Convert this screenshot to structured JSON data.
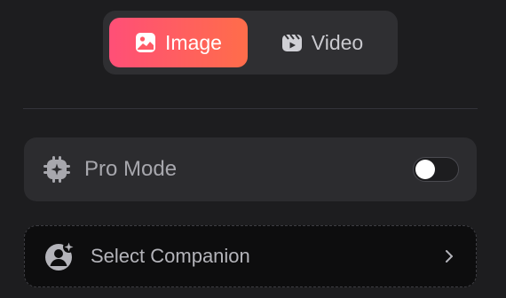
{
  "mode_switch": {
    "image_label": "Image",
    "video_label": "Video",
    "selected": "Image"
  },
  "pro_mode": {
    "label": "Pro Mode",
    "enabled": false
  },
  "companion": {
    "label": "Select Companion"
  },
  "colors": {
    "accent_start": "#ff4f77",
    "accent_end": "#ff6d4a",
    "background": "#1d1d1f"
  }
}
